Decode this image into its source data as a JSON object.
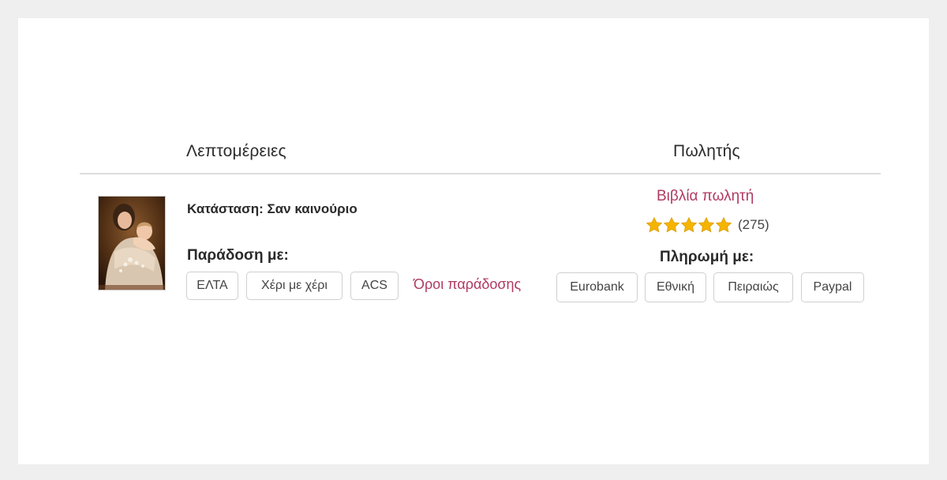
{
  "headers": {
    "details": "Λεπτομέρειες",
    "seller": "Πωλητής"
  },
  "listing": {
    "cover_icon": "book-cover-image",
    "condition": "Κατάσταση: Σαν καινούριο",
    "delivery_label": "Παράδοση με:",
    "delivery_methods": [
      "ΕΛΤΑ",
      "Χέρι με χέρι",
      "ACS"
    ],
    "delivery_terms_link": "Όροι παράδοσης"
  },
  "seller": {
    "books_link": "Βιβλία πωλητή",
    "rating_stars": 5,
    "rating_max": 5,
    "rating_count": "(275)",
    "payment_label": "Πληρωμή με:",
    "payment_methods": [
      "Eurobank",
      "Εθνική",
      "Πειραιώς",
      "Paypal"
    ]
  },
  "colors": {
    "link": "#b03a63",
    "star": "#f5b400",
    "background": "#efefef"
  }
}
